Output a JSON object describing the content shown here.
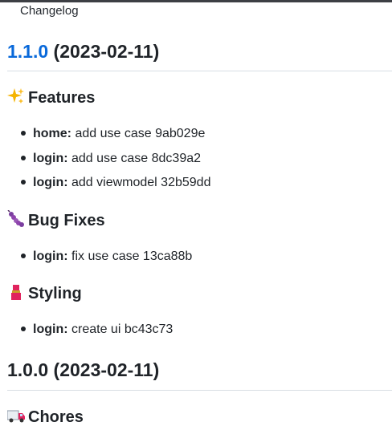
{
  "breadcrumb": "Changelog",
  "releases": [
    {
      "version": "1.1.0",
      "date": "(2023-02-11)",
      "linked": true,
      "sections": [
        {
          "icon": "sparkles-icon",
          "title": "Features",
          "items": [
            {
              "scope": "home:",
              "text": "add use case 9ab029e"
            },
            {
              "scope": "login:",
              "text": "add use case 8dc39a2"
            },
            {
              "scope": "login:",
              "text": "add viewmodel 32b59dd"
            }
          ]
        },
        {
          "icon": "bug-icon",
          "title": "Bug Fixes",
          "items": [
            {
              "scope": "login:",
              "text": "fix use case 13ca88b"
            }
          ]
        },
        {
          "icon": "lipstick-icon",
          "title": "Styling",
          "items": [
            {
              "scope": "login:",
              "text": "create ui bc43c73"
            }
          ]
        }
      ]
    },
    {
      "version": "1.0.0",
      "date": "(2023-02-11)",
      "linked": false,
      "sections": [
        {
          "icon": "truck-icon",
          "title": "Chores",
          "items": []
        }
      ]
    }
  ],
  "colors": {
    "link": "#0969da",
    "text": "#1f2328",
    "rule": "#d8dee4"
  }
}
